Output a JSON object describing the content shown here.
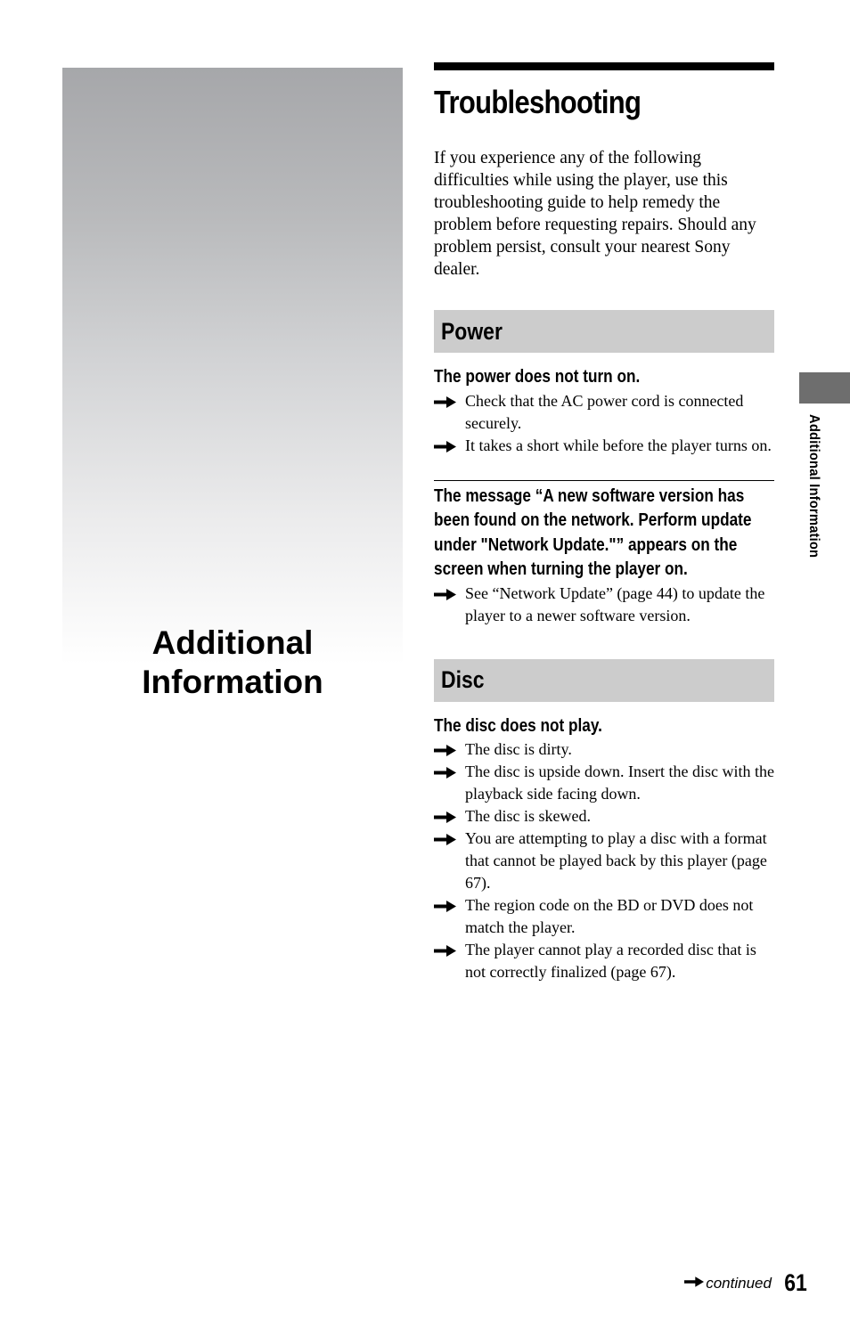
{
  "chapter": {
    "title_line1": "Additional",
    "title_line2": "Information",
    "side_label": "Additional Information"
  },
  "page": {
    "title": "Troubleshooting",
    "intro": "If you experience any of the following difficulties while using the player, use this troubleshooting guide to help remedy the problem before requesting repairs. Should any problem persist, consult your nearest Sony dealer.",
    "number": "61",
    "continued_label": "continued"
  },
  "sections": [
    {
      "title": "Power",
      "problems": [
        {
          "title": "The power does not turn on.",
          "solutions": [
            "Check that the AC power cord is connected securely.",
            "It takes a short while before the player turns on."
          ]
        },
        {
          "title": "The message “A new software version has been found on the network. Perform update under \"Network Update.\"” appears on the screen when turning the player on.",
          "solutions": [
            "See “Network Update” (page 44) to update the player to a newer software version."
          ]
        }
      ]
    },
    {
      "title": "Disc",
      "problems": [
        {
          "title": "The disc does not play.",
          "solutions": [
            "The disc is dirty.",
            "The disc is upside down. Insert the disc with the playback side facing down.",
            "The disc is skewed.",
            "You are attempting to play a disc with a format that cannot be played back by this player (page 67).",
            "The region code on the BD or DVD does not match the player.",
            "The player cannot play a recorded disc that is not correctly finalized (page 67)."
          ]
        }
      ]
    }
  ],
  "icons": {
    "solution_bullet": "arrow-right-icon",
    "continued": "arrow-right-icon"
  }
}
